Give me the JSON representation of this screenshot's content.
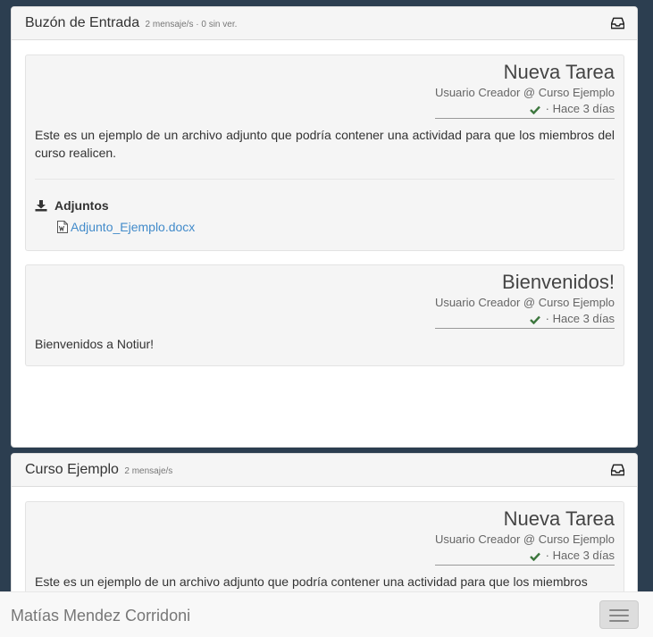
{
  "inbox": {
    "title": "Buzón de Entrada",
    "subtitle": "2 mensaje/s · 0 sin ver.",
    "messages": [
      {
        "title": "Nueva Tarea",
        "author": "Usuario Creador @ Curso Ejemplo",
        "time": "· Hace 3 días",
        "body": "Este es un ejemplo de un archivo adjunto que podría contener una actividad para que los miembros del curso realicen.",
        "attachments_label": "Adjuntos",
        "attachments": [
          "Adjunto_Ejemplo.docx"
        ]
      },
      {
        "title": "Bienvenidos!",
        "author": "Usuario Creador @ Curso Ejemplo",
        "time": "· Hace 3 días",
        "body": "Bienvenidos a Notiur!"
      }
    ]
  },
  "course": {
    "title": "Curso Ejemplo",
    "subtitle": "2 mensaje/s",
    "messages": [
      {
        "title": "Nueva Tarea",
        "author": "Usuario Creador @ Curso Ejemplo",
        "time": "· Hace 3 días",
        "body": "Este es un ejemplo de un archivo adjunto que podría contener una actividad para que los miembros"
      }
    ]
  },
  "footer": {
    "user_name": "Matías Mendez Corridoni"
  },
  "colors": {
    "background": "#2c3e50",
    "link": "#428bca",
    "check": "#3c763d"
  },
  "icons": {
    "inbox": "inbox-icon",
    "check": "check-icon",
    "download": "download-icon",
    "word_file": "word-file-icon",
    "menu": "hamburger-icon"
  }
}
